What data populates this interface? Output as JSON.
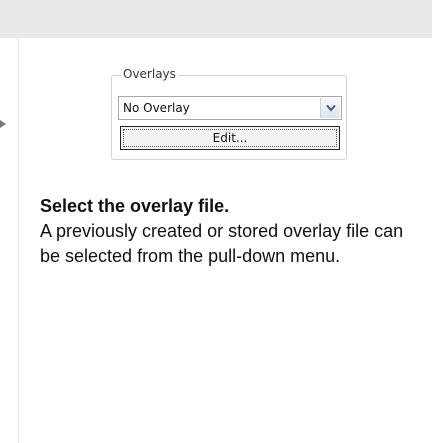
{
  "overlays_panel": {
    "group_label": "Overlays",
    "selected_overlay": "No Overlay",
    "edit_button_label": "Edit...",
    "dropdown_icon": "chevron-down-icon"
  },
  "caption": {
    "title": "Select the overlay file.",
    "body": "A previously created or stored overlay file can be selected from the pull-down menu."
  },
  "colors": {
    "band": "#e9e9e9",
    "text": "#111111",
    "dropdown_arrow": "#3a5a8c"
  }
}
